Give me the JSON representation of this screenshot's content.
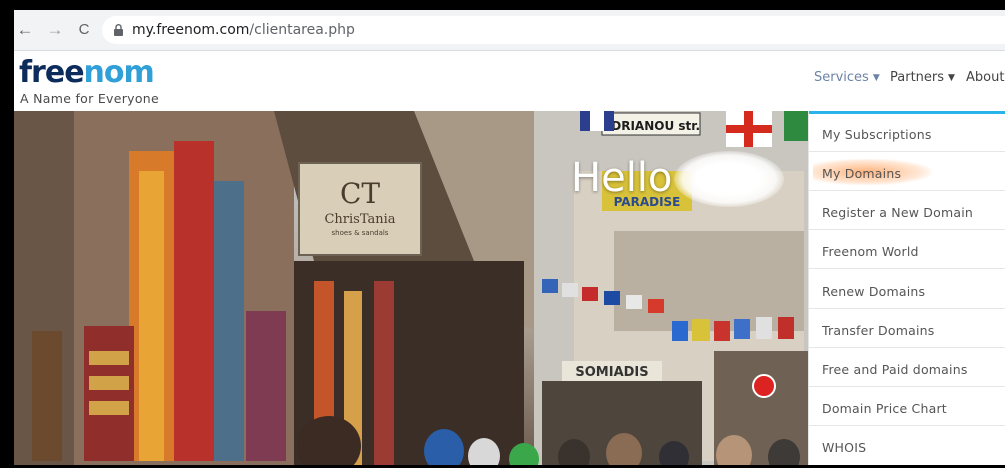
{
  "browser": {
    "url_host": "my.freenom.com",
    "url_path": "/clientarea.php",
    "back_icon": "←",
    "forward_icon": "→",
    "reload_icon": "C"
  },
  "site": {
    "logo_main": "free",
    "logo_accent": "nom",
    "tagline": "A Name for Everyone",
    "nav": {
      "services": "Services",
      "partners": "Partners",
      "about": "About"
    }
  },
  "hero": {
    "greeting": "Hello",
    "sign_ct": "CT",
    "sign_name": "ChrisTania",
    "sign_sub": "shoes & sandals",
    "street_sign": "ADRIANOU str.",
    "paradise_sign": "PARADISE",
    "omiadis_sign": "SOMIADIS"
  },
  "dropdown": {
    "items": [
      "My Subscriptions",
      "My Domains",
      "Register a New Domain",
      "Freenom World",
      "Renew Domains",
      "Transfer Domains",
      "Free and Paid domains",
      "Domain Price Chart",
      "WHOIS"
    ]
  },
  "colors": {
    "brand_dark": "#0d2c5c",
    "brand_accent": "#31a0d8",
    "dropdown_top_border": "#28b4ea"
  }
}
